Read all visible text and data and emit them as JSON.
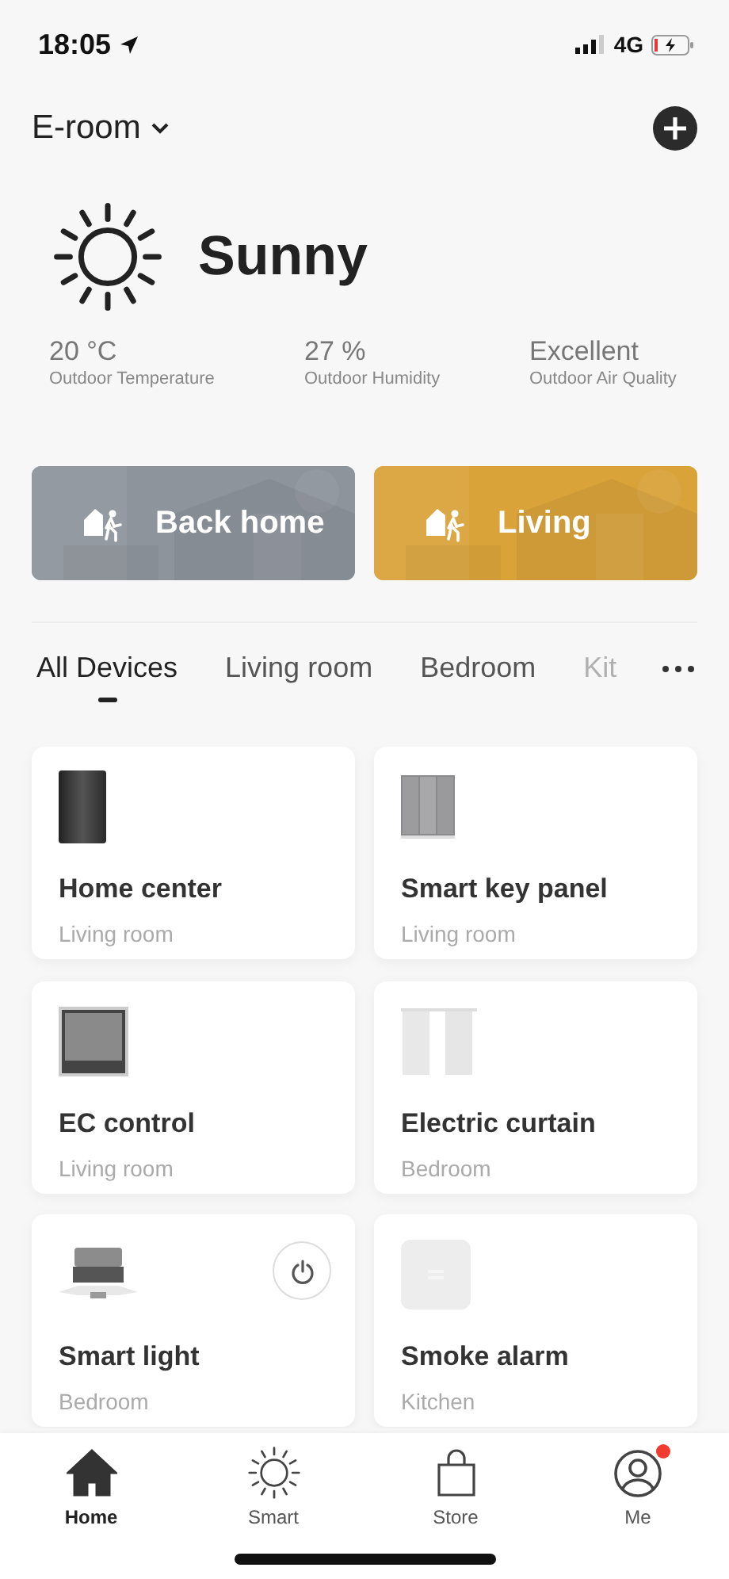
{
  "status_bar": {
    "time": "18:05",
    "network": "4G"
  },
  "header": {
    "home_name": "E-room"
  },
  "weather": {
    "condition": "Sunny",
    "stats": [
      {
        "value": "20 °C",
        "label": "Outdoor Temperature"
      },
      {
        "value": "27 %",
        "label": "Outdoor Humidity"
      },
      {
        "value": "Excellent",
        "label": "Outdoor Air Quality"
      }
    ]
  },
  "scenes": [
    {
      "label": "Back home",
      "color": "#8e949c"
    },
    {
      "label": "Living",
      "color": "#d9a33a"
    }
  ],
  "room_tabs": [
    {
      "label": "All Devices",
      "selected": true,
      "faded": false
    },
    {
      "label": "Living room",
      "selected": false,
      "faded": false
    },
    {
      "label": "Bedroom",
      "selected": false,
      "faded": false
    },
    {
      "label": "Kit",
      "selected": false,
      "faded": true
    }
  ],
  "devices": [
    {
      "kind": "hub",
      "name": "Home center",
      "room": "Living room",
      "power_button": false
    },
    {
      "kind": "key-panel",
      "name": "Smart key panel",
      "room": "Living room",
      "power_button": false
    },
    {
      "kind": "screen",
      "name": "EC control",
      "room": "Living room",
      "power_button": false
    },
    {
      "kind": "curtain",
      "name": "Electric curtain",
      "room": "Bedroom",
      "power_button": false
    },
    {
      "kind": "light",
      "name": "Smart light",
      "room": "Bedroom",
      "power_button": true
    },
    {
      "kind": "sensor",
      "name": "Smoke alarm",
      "room": "Kitchen",
      "power_button": false
    }
  ],
  "bottom_nav": [
    {
      "kind": "home",
      "label": "Home",
      "selected": true,
      "badge": false
    },
    {
      "kind": "sun",
      "label": "Smart",
      "selected": false,
      "badge": false
    },
    {
      "kind": "bag",
      "label": "Store",
      "selected": false,
      "badge": false
    },
    {
      "kind": "person",
      "label": "Me",
      "selected": false,
      "badge": true
    }
  ]
}
